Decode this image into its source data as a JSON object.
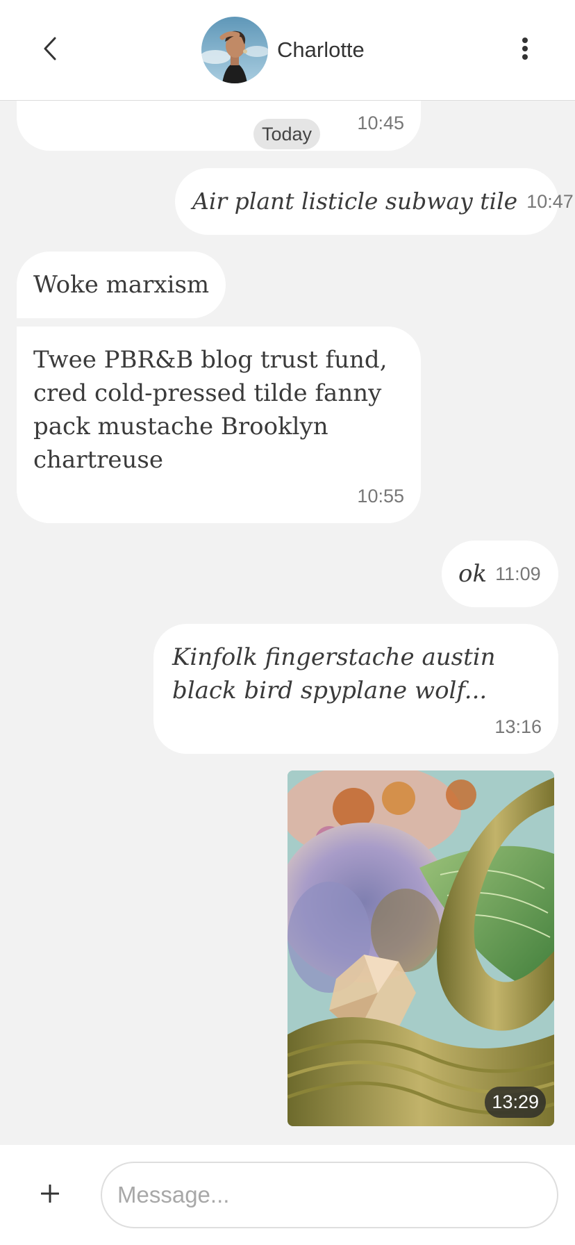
{
  "header": {
    "contact_name": "Charlotte",
    "back_icon": "chevron-left-icon",
    "menu_icon": "more-vertical-icon"
  },
  "messages": [
    {
      "direction": "in",
      "text": "",
      "time": "10:45"
    },
    {
      "direction": "out",
      "text": "Air plant listicle subway tile",
      "time": "10:47"
    },
    {
      "direction": "in",
      "text": "Woke marxism",
      "time": ""
    },
    {
      "direction": "in",
      "text": "Twee PBR&B blog trust fund, cred cold-pressed tilde fanny pack mustache Brooklyn chartreuse",
      "time": "10:55"
    },
    {
      "direction": "out",
      "text": "ok",
      "time": "11:09"
    },
    {
      "direction": "out",
      "text": "Kinfolk fingerstache austin black bird spyplane wolf...",
      "time": "13:16"
    },
    {
      "direction": "out",
      "type": "image",
      "time": "13:29"
    }
  ],
  "date_separator": "Today",
  "composer": {
    "placeholder": "Message...",
    "attach_icon": "plus-icon"
  },
  "colors": {
    "background": "#f2f2f2",
    "bubble": "#ffffff",
    "header": "#ffffff"
  }
}
